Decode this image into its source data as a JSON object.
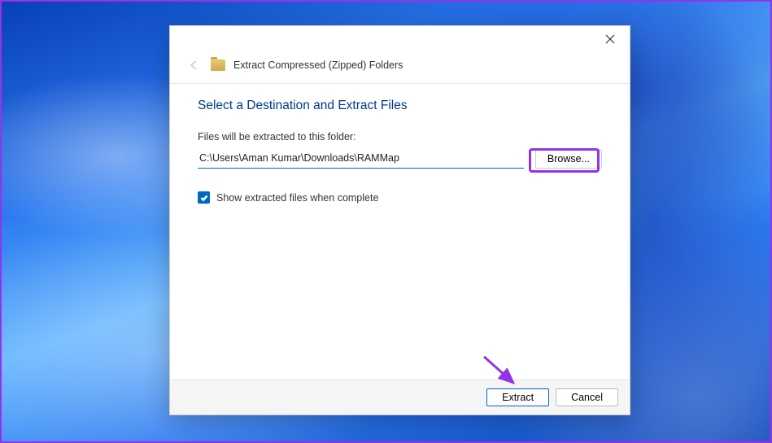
{
  "header": {
    "title": "Extract Compressed (Zipped) Folders"
  },
  "content": {
    "heading": "Select a Destination and Extract Files",
    "field_label": "Files will be extracted to this folder:",
    "path_value": "C:\\Users\\Aman Kumar\\Downloads\\RAMMap",
    "browse_label": "Browse...",
    "checkbox_label": "Show extracted files when complete",
    "checkbox_checked": true
  },
  "footer": {
    "extract_label": "Extract",
    "cancel_label": "Cancel"
  }
}
